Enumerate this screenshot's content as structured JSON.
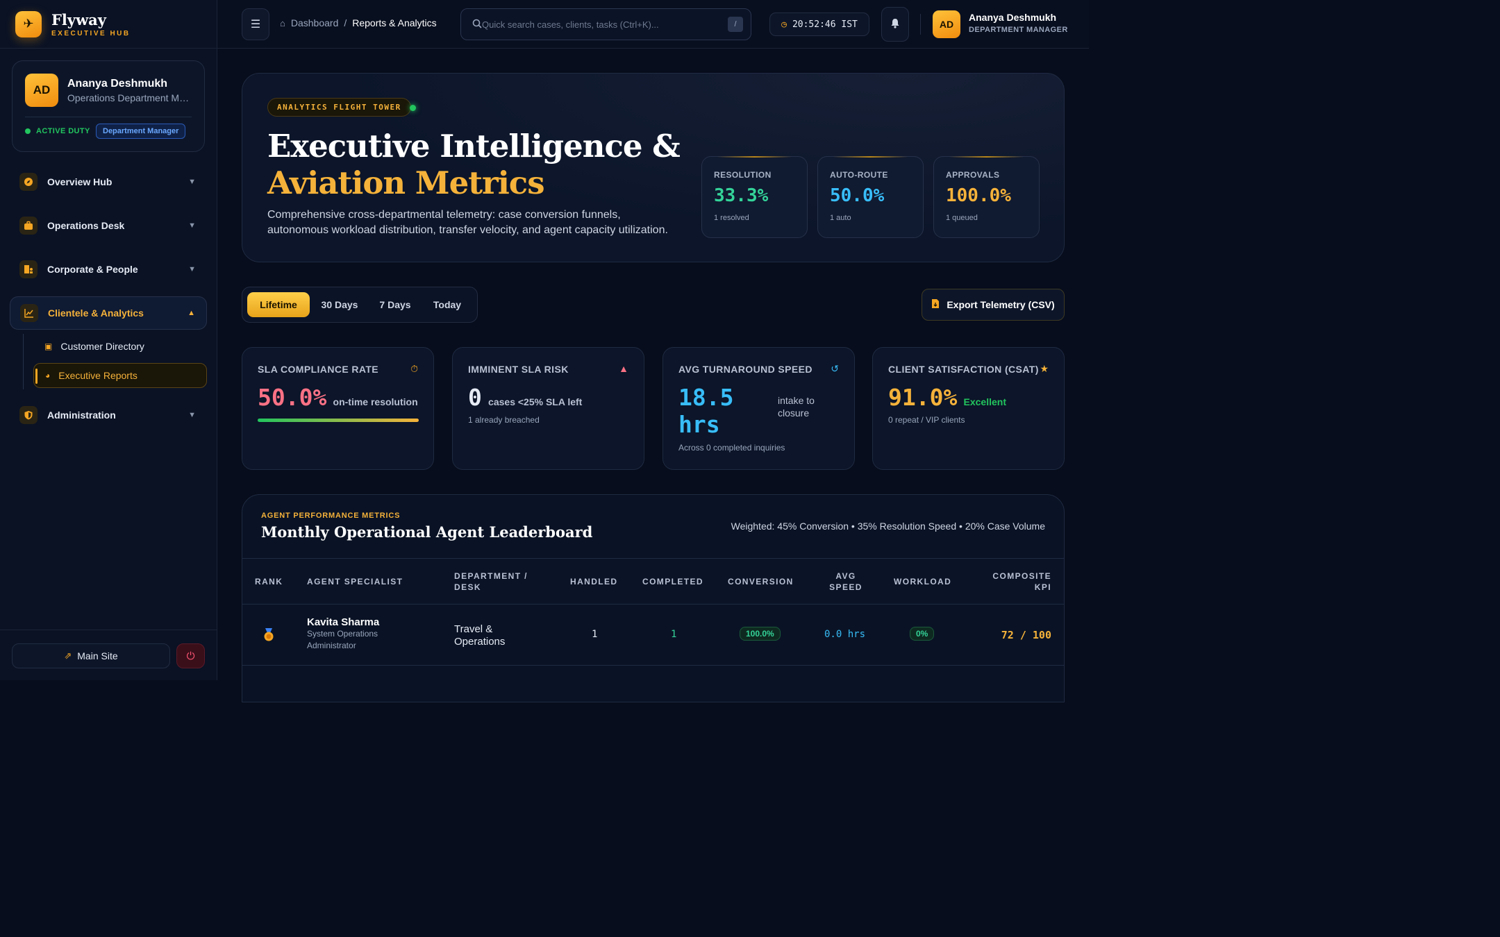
{
  "brand": {
    "name": "Flyway",
    "subtitle": "EXECUTIVE HUB"
  },
  "sidebar": {
    "profile": {
      "initials": "AD",
      "name": "Ananya Deshmukh",
      "role": "Operations Department Manager",
      "status": "ACTIVE DUTY",
      "badge": "Department Manager"
    },
    "nav": [
      {
        "label": "Overview Hub",
        "icon": "compass-icon"
      },
      {
        "label": "Operations Desk",
        "icon": "briefcase-icon"
      },
      {
        "label": "Corporate & People",
        "icon": "building-people-icon"
      },
      {
        "label": "Clientele & Analytics",
        "icon": "line-chart-icon",
        "expanded": true
      },
      {
        "label": "Administration",
        "icon": "shield-icon"
      }
    ],
    "subnav": [
      {
        "label": "Customer Directory",
        "icon": "contact-card-icon"
      },
      {
        "label": "Executive Reports",
        "icon": "pie-chart-icon",
        "active": true
      }
    ],
    "footer": {
      "main_site": "Main Site"
    }
  },
  "topbar": {
    "breadcrumb": {
      "home": "Dashboard",
      "separator": "/",
      "current": "Reports & Analytics"
    },
    "search_placeholder": "Quick search cases, clients, tasks (Ctrl+K)...",
    "search_shortcut": "/",
    "clock": "20:52:46 IST",
    "user": {
      "initials": "AD",
      "name": "Ananya Deshmukh",
      "role": "DEPARTMENT MANAGER"
    }
  },
  "hero": {
    "tag": "ANALYTICS FLIGHT TOWER",
    "title_line1": "Executive Intelligence &",
    "title_line2": "Aviation Metrics",
    "description": "Comprehensive cross-departmental telemetry: case conversion funnels, autonomous workload distribution, transfer velocity, and agent capacity utilization.",
    "stats": [
      {
        "label": "RESOLUTION",
        "value": "33.3%",
        "sub": "1 resolved",
        "color": "#34d399"
      },
      {
        "label": "AUTO-ROUTE",
        "value": "50.0%",
        "sub": "1 auto",
        "color": "#38bdf8"
      },
      {
        "label": "APPROVALS",
        "value": "100.0%",
        "sub": "1 queued",
        "color": "#f5b23a"
      }
    ]
  },
  "filters": {
    "tabs": [
      "Lifetime",
      "30 Days",
      "7 Days",
      "Today"
    ],
    "active": "Lifetime",
    "export": "Export Telemetry (CSV)"
  },
  "kpis": {
    "sla": {
      "label": "SLA COMPLIANCE RATE",
      "value": "50.0%",
      "unit": "on-time resolution",
      "progress": 1.0,
      "color": "#fb7185"
    },
    "risk": {
      "label": "IMMINENT SLA RISK",
      "value": "0",
      "unit": "cases <25% SLA left",
      "sub": "1 already breached"
    },
    "speed": {
      "label": "AVG TURNAROUND SPEED",
      "value_line1": "18.5",
      "value_line2": "hrs",
      "unit": "intake to closure",
      "sub": "Across 0 completed inquiries",
      "color": "#38bdf8"
    },
    "csat": {
      "label": "CLIENT SATISFACTION (CSAT)",
      "value": "91.0%",
      "rating": "Excellent",
      "sub": "0 repeat / VIP clients",
      "color": "#f5b23a"
    }
  },
  "leaderboard": {
    "kicker": "AGENT PERFORMANCE METRICS",
    "title": "Monthly Operational Agent Leaderboard",
    "weighting": "Weighted: 45% Conversion • 35% Resolution Speed • 20% Case Volume",
    "columns": {
      "rank": "RANK",
      "agent": "AGENT SPECIALIST",
      "dept_1": "DEPARTMENT /",
      "dept_2": "DESK",
      "handled": "HANDLED",
      "completed": "COMPLETED",
      "conversion": "CONVERSION",
      "speed_1": "AVG",
      "speed_2": "SPEED",
      "workload": "WORKLOAD",
      "kpi_1": "COMPOSITE",
      "kpi_2": "KPI"
    },
    "rows": [
      {
        "rank_icon": "gold-medal-icon",
        "name": "Kavita Sharma",
        "role_1": "System Operations",
        "role_2": "Administrator",
        "dept_1": "Travel &",
        "dept_2": "Operations",
        "handled": "1",
        "completed": "1",
        "conversion": "100.0%",
        "speed": "0.0 hrs",
        "workload": "0%",
        "kpi": "72 / 100"
      }
    ]
  }
}
